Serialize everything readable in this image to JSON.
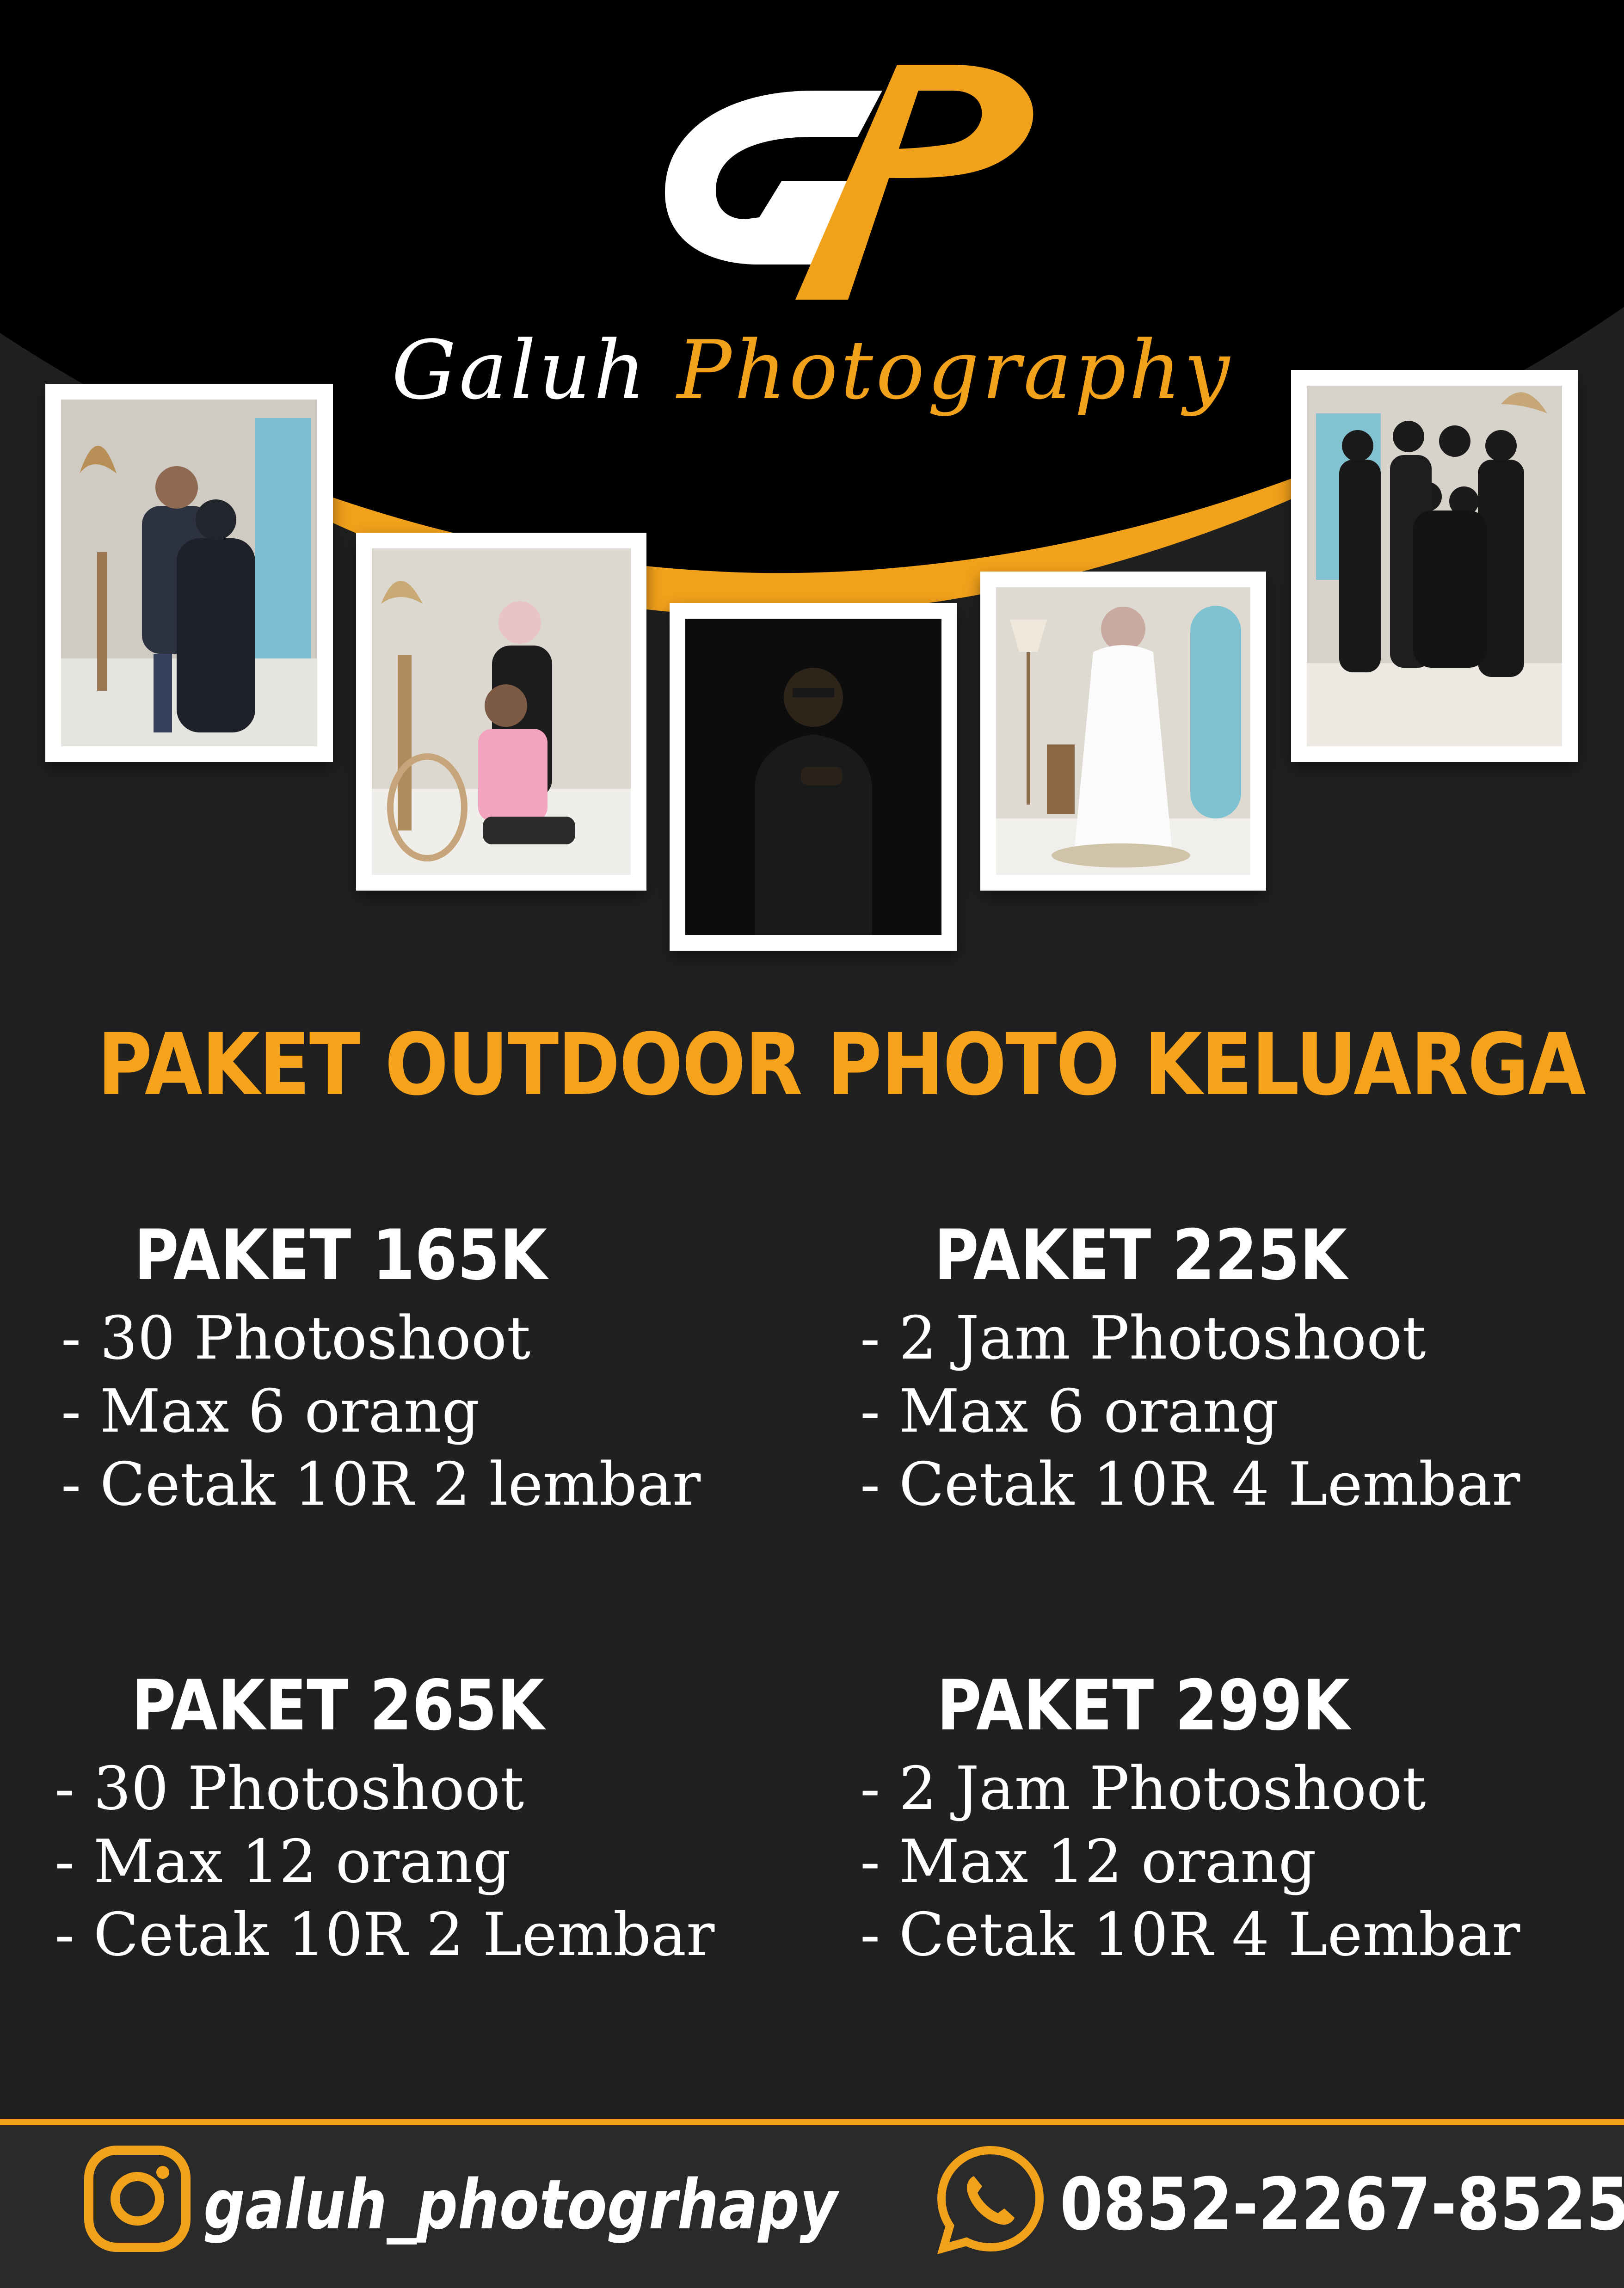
{
  "brand": {
    "monogram": "GP",
    "name_part1": "Galuh",
    "name_part2": "Photography"
  },
  "headline": "PAKET OUTDOOR PHOTO KELUARGA",
  "packages": [
    {
      "title": "PAKET 165K",
      "items": [
        "- 30 Photoshoot",
        "- Max 6 orang",
        "- Cetak 10R 2 lembar"
      ]
    },
    {
      "title": "PAKET 225K",
      "items": [
        "- 2 Jam Photoshoot",
        "- Max 6 orang",
        "- Cetak 10R 4 Lembar"
      ]
    },
    {
      "title": "PAKET 265K",
      "items": [
        "- 30 Photoshoot",
        "- Max 12 orang",
        "- Cetak 10R 2 Lembar"
      ]
    },
    {
      "title": "PAKET 299K",
      "items": [
        "- 2 Jam Photoshoot",
        "- Max 12 orang",
        "- Cetak 10R 4 Lembar"
      ]
    }
  ],
  "footer": {
    "instagram_icon": "instagram-icon",
    "instagram": "galuh_photogrhapy",
    "whatsapp_icon": "whatsapp-icon",
    "phone": "0852-2267-8525"
  },
  "colors": {
    "accent": "#f2a11b",
    "background": "#202020",
    "header": "#000000",
    "text": "#ffffff"
  }
}
